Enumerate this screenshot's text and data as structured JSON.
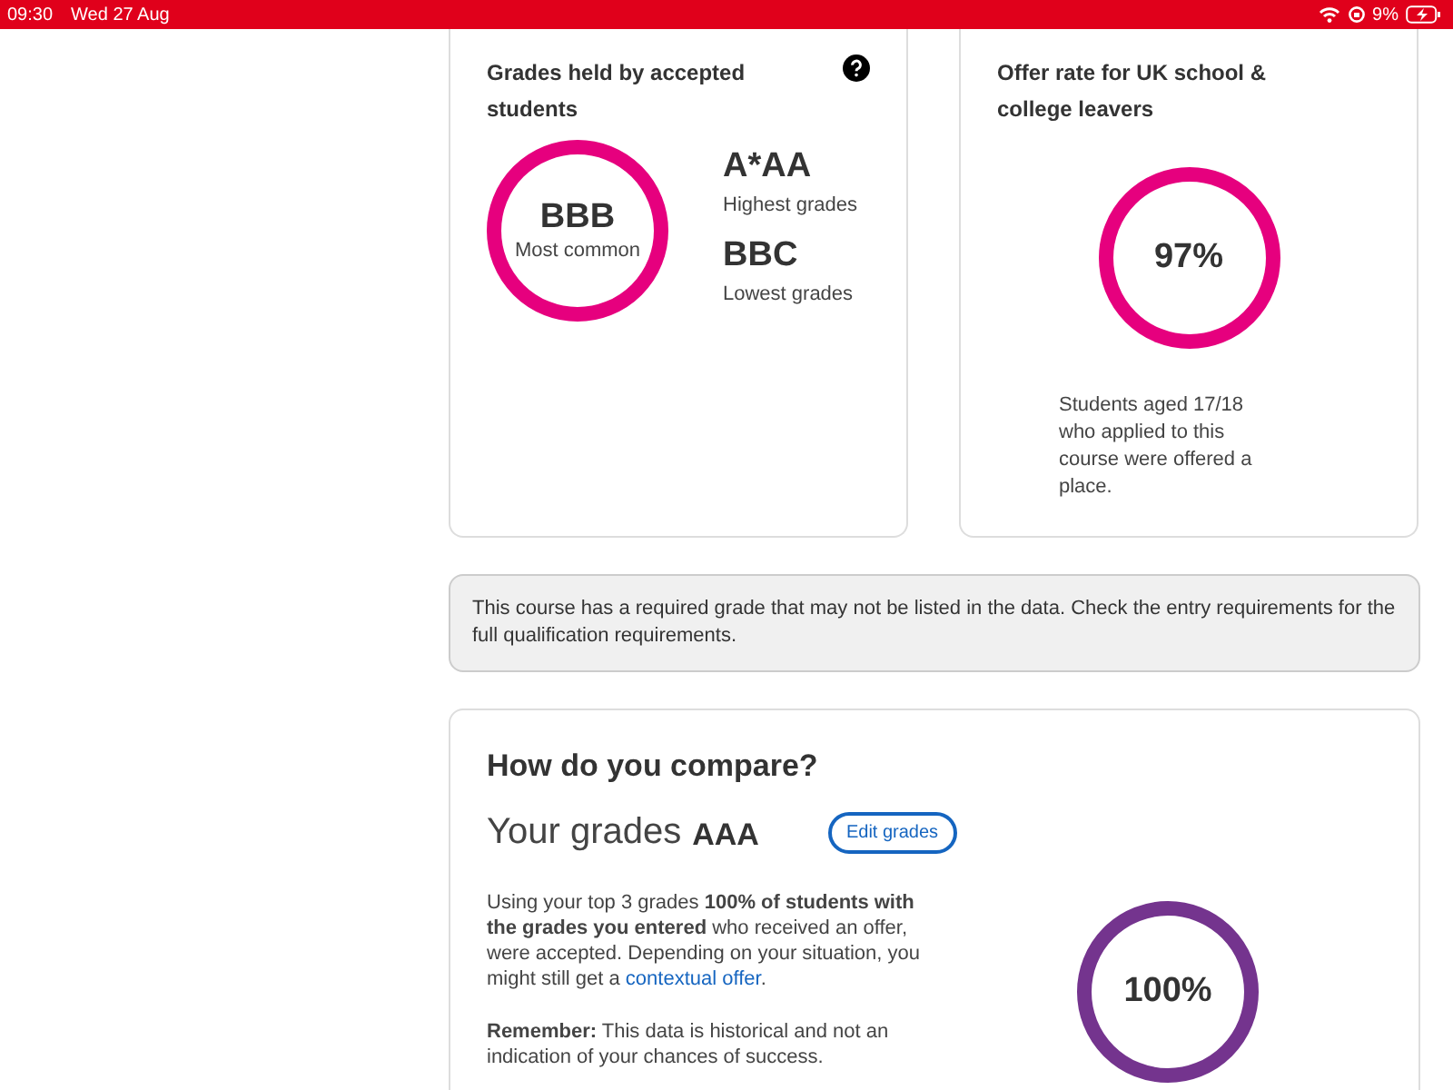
{
  "status_bar": {
    "time": "09:30",
    "date": "Wed 27 Aug",
    "battery": "9%"
  },
  "grades_card": {
    "title": "Grades held by accepted students",
    "most_common": "BBB",
    "most_common_label": "Most common",
    "highest": "A*AA",
    "highest_label": "Highest grades",
    "lowest": "BBC",
    "lowest_label": "Lowest grades"
  },
  "offer_card": {
    "title": "Offer rate for UK school & college leavers",
    "rate": "97%",
    "description": "Students aged 17/18 who applied to this course were offered a place."
  },
  "notice": "This course has a required grade that may not be listed in the data. Check the entry requirements for the full qualification requirements.",
  "compare": {
    "title": "How do you compare?",
    "grades_label": "Your grades",
    "grades": "AAA",
    "edit_button": "Edit grades",
    "text_before": "Using your top 3 grades **100% of students with the grades you entered** who received an offer, were accepted. Depending on your situation, you might still get a ",
    "link": "contextual offer",
    "text_after": ".",
    "remember": "**Remember:** This data is historical and not an indication of your chances of success.",
    "rate": "100%"
  }
}
